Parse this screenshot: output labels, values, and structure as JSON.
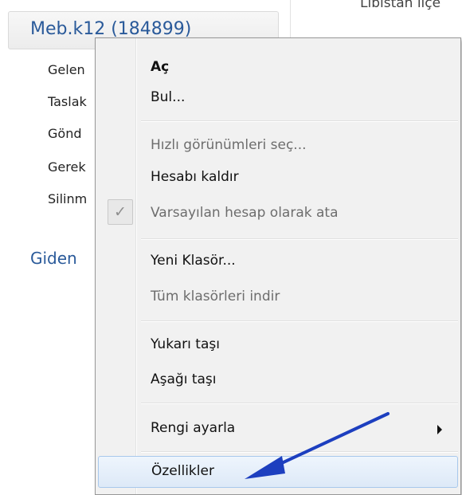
{
  "background": {
    "account_label": "Meb.k12 (184899)",
    "right_panel_text": "Libistan ilçe",
    "folders": [
      "Gelen",
      "Taslak",
      "Gönd",
      "Gerek",
      "Silinm"
    ],
    "section_label": "Giden"
  },
  "menu": {
    "items": [
      {
        "label": "Aç"
      },
      {
        "label": "Bul..."
      },
      {
        "label": "Hızlı görünümleri seç..."
      },
      {
        "label": "Hesabı kaldır"
      },
      {
        "label": "Varsayılan hesap olarak ata"
      },
      {
        "label": "Yeni Klasör..."
      },
      {
        "label": "Tüm klasörleri indir"
      },
      {
        "label": "Yukarı taşı"
      },
      {
        "label": "Aşağı taşı"
      },
      {
        "label": "Rengi ayarla"
      },
      {
        "label": "Özellikler"
      }
    ],
    "check_glyph": "✓"
  },
  "annotation": {
    "arrow_color": "#1d3fbf"
  }
}
